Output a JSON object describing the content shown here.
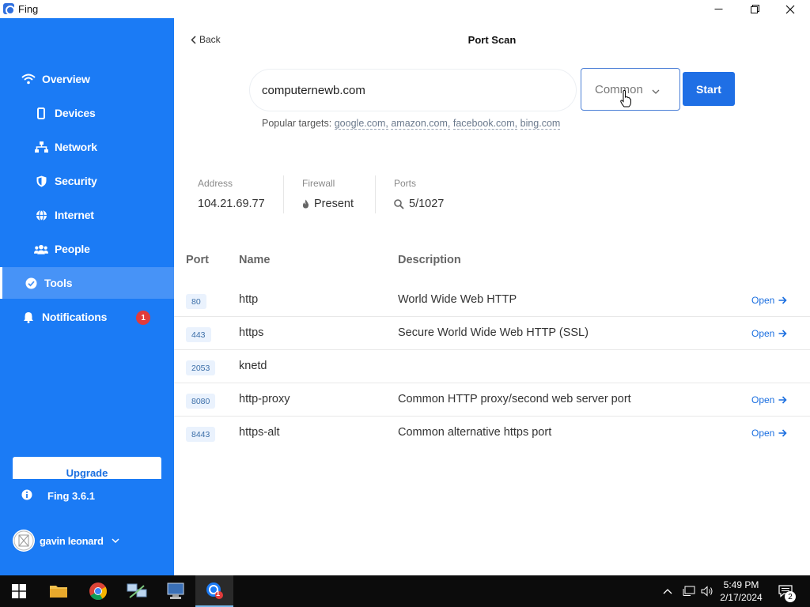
{
  "window": {
    "title": "Fing"
  },
  "sidebar": {
    "items": [
      {
        "label": "Overview",
        "icon": "wifi-icon"
      },
      {
        "label": "Devices",
        "icon": "phone-icon"
      },
      {
        "label": "Network",
        "icon": "network-icon"
      },
      {
        "label": "Security",
        "icon": "shield-icon"
      },
      {
        "label": "Internet",
        "icon": "globe-icon"
      },
      {
        "label": "People",
        "icon": "people-icon"
      },
      {
        "label": "Tools",
        "icon": "check-circle-icon",
        "active": true
      },
      {
        "label": "Notifications",
        "icon": "bell-icon",
        "badge": "1"
      }
    ],
    "upgrade_label": "Upgrade",
    "version": "Fing 3.6.1",
    "user": "gavin leonard"
  },
  "header": {
    "back_label": "Back",
    "title": "Port Scan"
  },
  "scan": {
    "target_value": "computernewb.com",
    "profile": "Common",
    "start_label": "Start",
    "popular_label": "Popular targets:",
    "popular_targets": [
      "google.com,",
      "amazon.com,",
      "facebook.com,",
      "bing.com"
    ]
  },
  "stats": {
    "address_label": "Address",
    "address_value": "104.21.69.77",
    "firewall_label": "Firewall",
    "firewall_value": "Present",
    "ports_label": "Ports",
    "ports_value": "5/1027"
  },
  "table": {
    "headers": {
      "port": "Port",
      "name": "Name",
      "description": "Description"
    },
    "rows": [
      {
        "port": "80",
        "name": "http",
        "description": "World Wide Web HTTP",
        "action": "Open"
      },
      {
        "port": "443",
        "name": "https",
        "description": "Secure World Wide Web HTTP (SSL)",
        "action": "Open"
      },
      {
        "port": "2053",
        "name": "knetd",
        "description": "",
        "action": ""
      },
      {
        "port": "8080",
        "name": "http-proxy",
        "description": "Common HTTP proxy/second web server port",
        "action": "Open"
      },
      {
        "port": "8443",
        "name": "https-alt",
        "description": "Common alternative https port",
        "action": "Open"
      }
    ]
  },
  "taskbar": {
    "time": "5:49 PM",
    "date": "2/17/2024",
    "notification_count": "2",
    "fing_badge": "1"
  },
  "colors": {
    "sidebar": "#1b7bf5",
    "accent": "#1f6fe5",
    "badge": "#e23b3b"
  }
}
